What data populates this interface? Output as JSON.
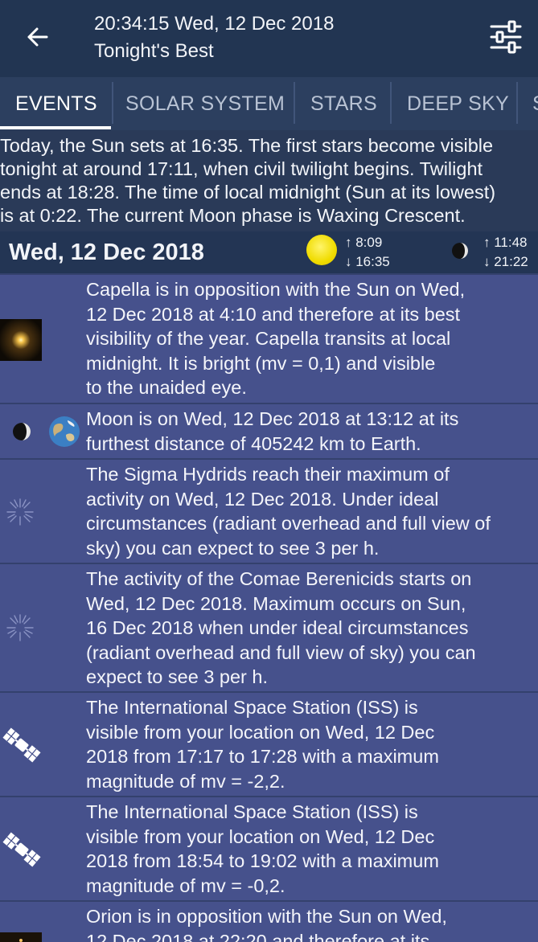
{
  "header": {
    "datetime": "20:34:15 Wed, 12 Dec 2018",
    "subtitle": "Tonight's Best",
    "back_icon": "arrow-left-icon",
    "filter_icon": "sliders-icon"
  },
  "tabs": [
    {
      "label": "EVENTS",
      "active": true
    },
    {
      "label": "SOLAR SYSTEM",
      "active": false
    },
    {
      "label": "STARS",
      "active": false
    },
    {
      "label": "DEEP SKY",
      "active": false
    },
    {
      "label": "S",
      "active": false
    }
  ],
  "intro": {
    "lines": [
      "Today, the Sun sets at 16:35. The first stars become visible",
      "tonight at around 17:11, when civil twilight begins. Twilight",
      "ends at 18:28. The time of local midnight (Sun at its lowest)",
      "is at 0:22. The current Moon phase is Waxing Crescent."
    ]
  },
  "day": {
    "date": "Wed, 12 Dec 2018",
    "sun_rise": "↑ 8:09",
    "sun_set": "↓ 16:35",
    "moon_rise": "↑ 11:48",
    "moon_set": "↓ 21:22"
  },
  "events": [
    {
      "icon": "star-capella-icon",
      "lines": [
        "Capella is in opposition with the Sun on Wed,",
        "12 Dec 2018 at 4:10 and therefore at its best",
        "visibility of the year. Capella transits at local",
        "midnight. It is bright (mv = 0,1) and visible",
        "to the unaided eye."
      ]
    },
    {
      "icon": "moon-earth-icon",
      "lines": [
        "Moon is on Wed, 12 Dec 2018 at 13:12 at its",
        "furthest distance of 405242 km to Earth."
      ]
    },
    {
      "icon": "meteor-shower-icon",
      "lines": [
        "The Sigma Hydrids reach their maximum of",
        "activity on Wed, 12 Dec 2018. Under ideal",
        "circumstances (radiant overhead and full view of",
        "sky) you can expect to see 3 per h."
      ]
    },
    {
      "icon": "meteor-shower-icon",
      "lines": [
        "The activity of the Comae Berenicids starts on",
        "Wed, 12 Dec 2018. Maximum occurs on Sun,",
        "16 Dec 2018 when under ideal circumstances",
        "(radiant overhead and full view of sky) you can",
        "expect to see 3 per h."
      ]
    },
    {
      "icon": "satellite-icon",
      "lines": [
        "The International Space Station (ISS) is",
        "visible from your location on Wed, 12 Dec",
        "2018 from 17:17 to 17:28 with a maximum",
        "magnitude of mv = -2,2."
      ]
    },
    {
      "icon": "satellite-icon",
      "lines": [
        "The International Space Station (ISS) is",
        "visible from your location on Wed, 12 Dec",
        "2018 from 18:54 to 19:02 with a maximum",
        "magnitude of mv = -0,2."
      ]
    },
    {
      "icon": "star-orion-icon",
      "lines": [
        "Orion is in opposition with the Sun on Wed,",
        "12 Dec 2018 at 22:20 and therefore at its"
      ]
    }
  ],
  "colors": {
    "header_bg": "#223552",
    "tab_bg": "#2c3f5f",
    "page_bg": "#2a3a58",
    "event_row_bg": "#46518c",
    "sun_yellow": "#f0dc00"
  }
}
